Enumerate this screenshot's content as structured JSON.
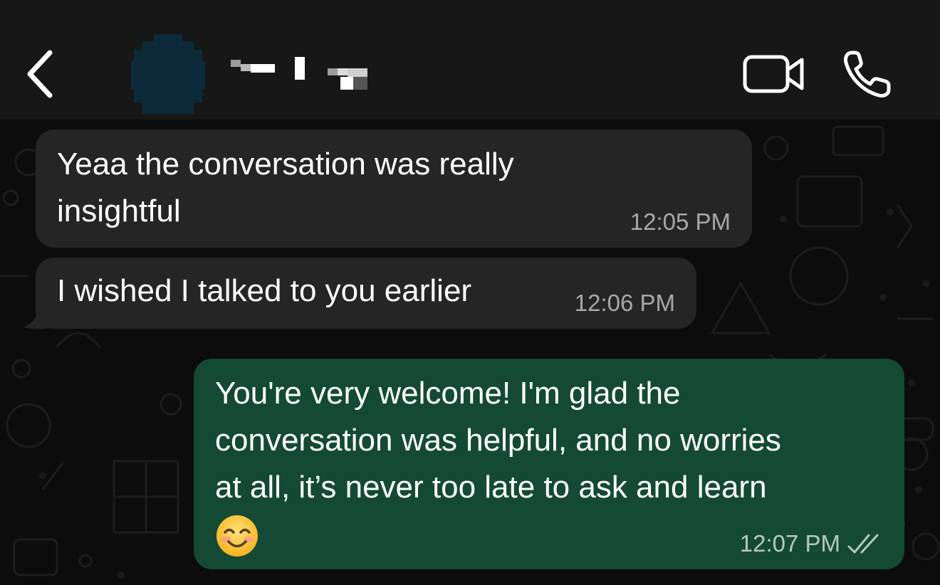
{
  "header": {
    "back_icon": "chevron-left-icon",
    "avatar_icon": "blurred-avatar",
    "contact_name_icon": "pixelated-contact-name",
    "video_icon": "video-camera-icon",
    "call_icon": "phone-icon"
  },
  "messages": [
    {
      "direction": "incoming",
      "text": "Yeaa the conversation was really\ninsightful",
      "time": "12:05 PM"
    },
    {
      "direction": "incoming",
      "text": "I wished I talked to you earlier",
      "time": "12:06 PM"
    },
    {
      "direction": "outgoing",
      "text": "You're very welcome! I'm glad the\nconversation was helpful, and no worries\nat all, it’s never too late to ask and learn",
      "emoji": "smiling-face-emoji",
      "time": "12:07 PM",
      "status": "read-double-check-icon"
    }
  ],
  "colors": {
    "header_bg": "#171717",
    "chat_bg": "#0c0c0c",
    "incoming_bubble": "#252525",
    "outgoing_bubble": "#144a33",
    "timestamp": "#a8a8a8",
    "avatar": "#0d2a3a"
  }
}
